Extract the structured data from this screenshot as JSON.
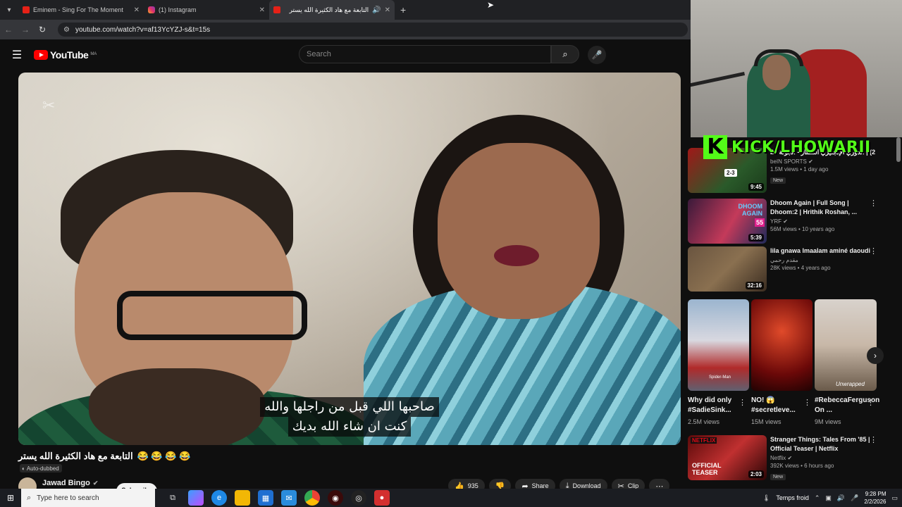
{
  "browser": {
    "tabs": [
      {
        "label": "Eminem - Sing For The Moment",
        "active": false
      },
      {
        "label": "(1) Instagram",
        "active": false
      },
      {
        "label": "التابعة مع هاد الكثيرة الله يستر",
        "active": true
      }
    ],
    "new_tab": "+",
    "url": "youtube.com/watch?v=af13YcYZJ-s&t=15s"
  },
  "youtube": {
    "logo_text": "YouTube",
    "country_code": "MA",
    "search_placeholder": "Search"
  },
  "video": {
    "subtitle_line1": "صاحبها اللي قبل من راجلها والله",
    "subtitle_line2": "كنت ان شاء الله بديك",
    "title": "التابعة مع هاد الكثيرة الله يستر",
    "title_emojis": "😂 😂 😂 😂",
    "auto_dubbed": "Auto-dubbed",
    "channel": "Jawad Bingo",
    "subscribe": "Subscribe",
    "likes": "935",
    "share": "Share",
    "download": "Download",
    "clip": "Clip"
  },
  "overlay": {
    "kick_text": "KICK/LHOWARII"
  },
  "recommendations": [
    {
      "title": "2) | الدوري الإنجليزي الممتاز - الجولة 24",
      "channel": "beIN SPORTS",
      "meta": "1.5M views • 1 day ago",
      "badge": "New",
      "duration": "9:45",
      "score": "2-3"
    },
    {
      "title": "Dhoom Again | Full Song | Dhoom:2 | Hrithik Roshan, ...",
      "channel": "YRF",
      "meta": "56M views • 10 years ago",
      "duration": "5:39",
      "thumb_text": "DHOOM AGAIN",
      "thumb_tag": "55"
    },
    {
      "title": "lila gnawa lmaalam aminé daoudi",
      "channel": "مقدم رحمي",
      "meta": "28K views • 4 years ago",
      "duration": "32:16"
    },
    {
      "title": "Stranger Things: Tales From '85 | Official Teaser | Netflix",
      "channel": "Netflix",
      "meta": "392K views • 6 hours ago",
      "badge": "New",
      "duration": "2:03",
      "thumb_brand": "NETFLIX",
      "thumb_text": "OFFICIAL TEASER"
    }
  ],
  "shorts": [
    {
      "title": "Why did only #SadieSink...",
      "views": "2.5M views",
      "thumb_text": "Spider-Man"
    },
    {
      "title": "NO! 😱 #secretleve...",
      "views": "15M views"
    },
    {
      "title": "#RebeccaFerguson On ...",
      "views": "9M views",
      "thumb_text": "Unwrapped"
    }
  ],
  "taskbar": {
    "search_placeholder": "Type here to search",
    "weather": "Temps froid",
    "time": "9:28 PM",
    "date": "2/2/2026"
  },
  "colors": {
    "youtube_red": "#ff0000",
    "kick_green": "#53fc18",
    "background": "#0f0f0f"
  }
}
